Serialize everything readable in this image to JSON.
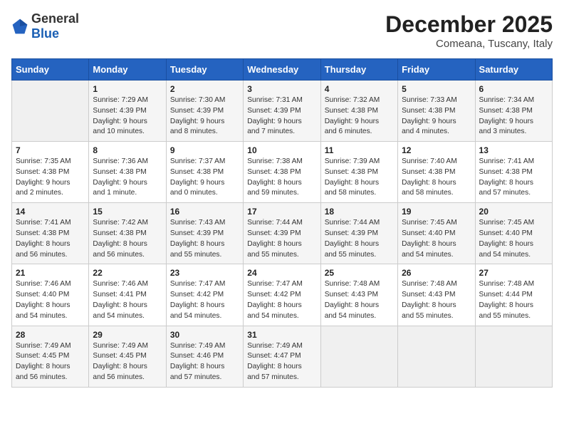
{
  "logo": {
    "general": "General",
    "blue": "Blue"
  },
  "title": "December 2025",
  "subtitle": "Comeana, Tuscany, Italy",
  "days": [
    "Sunday",
    "Monday",
    "Tuesday",
    "Wednesday",
    "Thursday",
    "Friday",
    "Saturday"
  ],
  "weeks": [
    [
      {
        "day": "",
        "info": ""
      },
      {
        "day": "1",
        "info": "Sunrise: 7:29 AM\nSunset: 4:39 PM\nDaylight: 9 hours\nand 10 minutes."
      },
      {
        "day": "2",
        "info": "Sunrise: 7:30 AM\nSunset: 4:39 PM\nDaylight: 9 hours\nand 8 minutes."
      },
      {
        "day": "3",
        "info": "Sunrise: 7:31 AM\nSunset: 4:39 PM\nDaylight: 9 hours\nand 7 minutes."
      },
      {
        "day": "4",
        "info": "Sunrise: 7:32 AM\nSunset: 4:38 PM\nDaylight: 9 hours\nand 6 minutes."
      },
      {
        "day": "5",
        "info": "Sunrise: 7:33 AM\nSunset: 4:38 PM\nDaylight: 9 hours\nand 4 minutes."
      },
      {
        "day": "6",
        "info": "Sunrise: 7:34 AM\nSunset: 4:38 PM\nDaylight: 9 hours\nand 3 minutes."
      }
    ],
    [
      {
        "day": "7",
        "info": "Sunrise: 7:35 AM\nSunset: 4:38 PM\nDaylight: 9 hours\nand 2 minutes."
      },
      {
        "day": "8",
        "info": "Sunrise: 7:36 AM\nSunset: 4:38 PM\nDaylight: 9 hours\nand 1 minute."
      },
      {
        "day": "9",
        "info": "Sunrise: 7:37 AM\nSunset: 4:38 PM\nDaylight: 9 hours\nand 0 minutes."
      },
      {
        "day": "10",
        "info": "Sunrise: 7:38 AM\nSunset: 4:38 PM\nDaylight: 8 hours\nand 59 minutes."
      },
      {
        "day": "11",
        "info": "Sunrise: 7:39 AM\nSunset: 4:38 PM\nDaylight: 8 hours\nand 58 minutes."
      },
      {
        "day": "12",
        "info": "Sunrise: 7:40 AM\nSunset: 4:38 PM\nDaylight: 8 hours\nand 58 minutes."
      },
      {
        "day": "13",
        "info": "Sunrise: 7:41 AM\nSunset: 4:38 PM\nDaylight: 8 hours\nand 57 minutes."
      }
    ],
    [
      {
        "day": "14",
        "info": "Sunrise: 7:41 AM\nSunset: 4:38 PM\nDaylight: 8 hours\nand 56 minutes."
      },
      {
        "day": "15",
        "info": "Sunrise: 7:42 AM\nSunset: 4:38 PM\nDaylight: 8 hours\nand 56 minutes."
      },
      {
        "day": "16",
        "info": "Sunrise: 7:43 AM\nSunset: 4:39 PM\nDaylight: 8 hours\nand 55 minutes."
      },
      {
        "day": "17",
        "info": "Sunrise: 7:44 AM\nSunset: 4:39 PM\nDaylight: 8 hours\nand 55 minutes."
      },
      {
        "day": "18",
        "info": "Sunrise: 7:44 AM\nSunset: 4:39 PM\nDaylight: 8 hours\nand 55 minutes."
      },
      {
        "day": "19",
        "info": "Sunrise: 7:45 AM\nSunset: 4:40 PM\nDaylight: 8 hours\nand 54 minutes."
      },
      {
        "day": "20",
        "info": "Sunrise: 7:45 AM\nSunset: 4:40 PM\nDaylight: 8 hours\nand 54 minutes."
      }
    ],
    [
      {
        "day": "21",
        "info": "Sunrise: 7:46 AM\nSunset: 4:40 PM\nDaylight: 8 hours\nand 54 minutes."
      },
      {
        "day": "22",
        "info": "Sunrise: 7:46 AM\nSunset: 4:41 PM\nDaylight: 8 hours\nand 54 minutes."
      },
      {
        "day": "23",
        "info": "Sunrise: 7:47 AM\nSunset: 4:42 PM\nDaylight: 8 hours\nand 54 minutes."
      },
      {
        "day": "24",
        "info": "Sunrise: 7:47 AM\nSunset: 4:42 PM\nDaylight: 8 hours\nand 54 minutes."
      },
      {
        "day": "25",
        "info": "Sunrise: 7:48 AM\nSunset: 4:43 PM\nDaylight: 8 hours\nand 54 minutes."
      },
      {
        "day": "26",
        "info": "Sunrise: 7:48 AM\nSunset: 4:43 PM\nDaylight: 8 hours\nand 55 minutes."
      },
      {
        "day": "27",
        "info": "Sunrise: 7:48 AM\nSunset: 4:44 PM\nDaylight: 8 hours\nand 55 minutes."
      }
    ],
    [
      {
        "day": "28",
        "info": "Sunrise: 7:49 AM\nSunset: 4:45 PM\nDaylight: 8 hours\nand 56 minutes."
      },
      {
        "day": "29",
        "info": "Sunrise: 7:49 AM\nSunset: 4:45 PM\nDaylight: 8 hours\nand 56 minutes."
      },
      {
        "day": "30",
        "info": "Sunrise: 7:49 AM\nSunset: 4:46 PM\nDaylight: 8 hours\nand 57 minutes."
      },
      {
        "day": "31",
        "info": "Sunrise: 7:49 AM\nSunset: 4:47 PM\nDaylight: 8 hours\nand 57 minutes."
      },
      {
        "day": "",
        "info": ""
      },
      {
        "day": "",
        "info": ""
      },
      {
        "day": "",
        "info": ""
      }
    ]
  ]
}
